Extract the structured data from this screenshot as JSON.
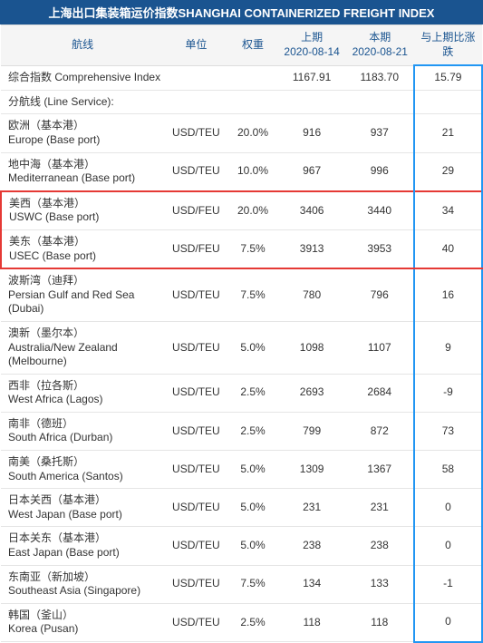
{
  "title": "上海出口集装箱运价指数SHANGHAI CONTAINERIZED FREIGHT INDEX",
  "headers": {
    "route": "航线",
    "unit": "单位",
    "weight": "权重",
    "prev": "上期\n2020-08-14",
    "curr": "本期\n2020-08-21",
    "diff": "与上期比涨跌"
  },
  "rows": [
    {
      "route": "综合指数 Comprehensive Index",
      "unit": "",
      "weight": "",
      "prev": "1167.91",
      "curr": "1183.70",
      "diff": "15.79",
      "diffHighlightTop": true
    },
    {
      "route": "分航线 (Line Service):",
      "unit": "",
      "weight": "",
      "prev": "",
      "curr": "",
      "diff": ""
    },
    {
      "route": "欧洲（基本港）\nEurope (Base port)",
      "unit": "USD/TEU",
      "weight": "20.0%",
      "prev": "916",
      "curr": "937",
      "diff": "21"
    },
    {
      "route": "地中海（基本港）\nMediterranean (Base port)",
      "unit": "USD/TEU",
      "weight": "10.0%",
      "prev": "967",
      "curr": "996",
      "diff": "29"
    },
    {
      "route": "美西（基本港）\nUSWC (Base port)",
      "unit": "USD/FEU",
      "weight": "20.0%",
      "prev": "3406",
      "curr": "3440",
      "diff": "34",
      "redTop": true
    },
    {
      "route": "美东（基本港）\nUSEC (Base port)",
      "unit": "USD/FEU",
      "weight": "7.5%",
      "prev": "3913",
      "curr": "3953",
      "diff": "40",
      "redBottom": true
    },
    {
      "route": "波斯湾（迪拜）\nPersian Gulf and Red Sea (Dubai)",
      "unit": "USD/TEU",
      "weight": "7.5%",
      "prev": "780",
      "curr": "796",
      "diff": "16"
    },
    {
      "route": "澳新（墨尔本）\nAustralia/New Zealand (Melbourne)",
      "unit": "USD/TEU",
      "weight": "5.0%",
      "prev": "1098",
      "curr": "1107",
      "diff": "9"
    },
    {
      "route": "西非（拉各斯）\nWest Africa (Lagos)",
      "unit": "USD/TEU",
      "weight": "2.5%",
      "prev": "2693",
      "curr": "2684",
      "diff": "-9"
    },
    {
      "route": "南非（德班）\nSouth Africa (Durban)",
      "unit": "USD/TEU",
      "weight": "2.5%",
      "prev": "799",
      "curr": "872",
      "diff": "73"
    },
    {
      "route": "南美（桑托斯）\nSouth America (Santos)",
      "unit": "USD/TEU",
      "weight": "5.0%",
      "prev": "1309",
      "curr": "1367",
      "diff": "58"
    },
    {
      "route": "日本关西（基本港）\nWest Japan (Base port)",
      "unit": "USD/TEU",
      "weight": "5.0%",
      "prev": "231",
      "curr": "231",
      "diff": "0"
    },
    {
      "route": "日本关东（基本港）\nEast Japan (Base port)",
      "unit": "USD/TEU",
      "weight": "5.0%",
      "prev": "238",
      "curr": "238",
      "diff": "0"
    },
    {
      "route": "东南亚（新加坡）\nSoutheast Asia (Singapore)",
      "unit": "USD/TEU",
      "weight": "7.5%",
      "prev": "134",
      "curr": "133",
      "diff": "-1"
    },
    {
      "route": "韩国（釜山）\nKorea (Pusan)",
      "unit": "USD/TEU",
      "weight": "2.5%",
      "prev": "118",
      "curr": "118",
      "diff": "0",
      "diffHighlightBottom": true
    }
  ]
}
